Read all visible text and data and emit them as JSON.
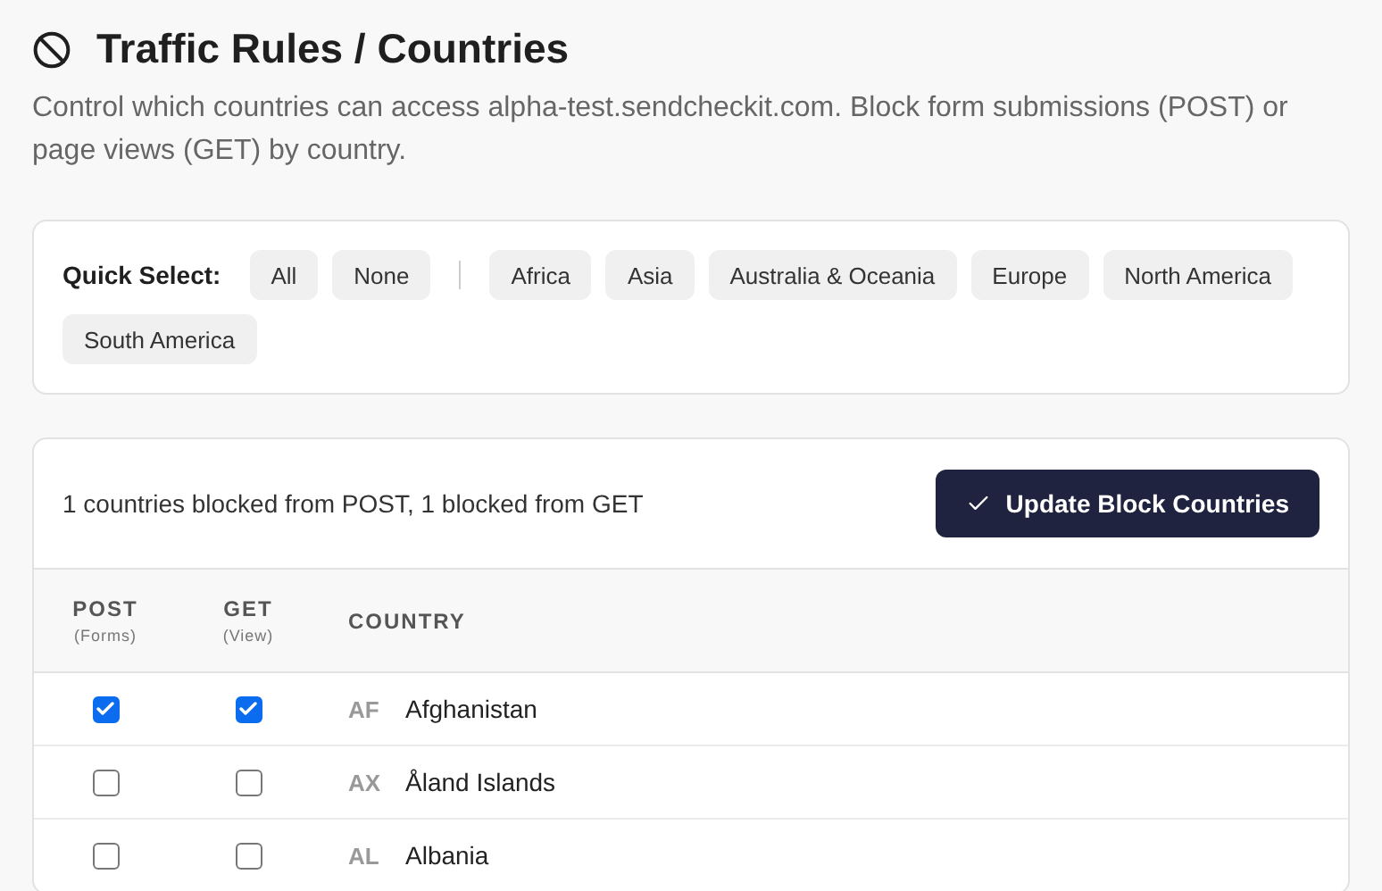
{
  "title": "Traffic Rules / Countries",
  "description": "Control which countries can access alpha-test.sendcheckit.com. Block form submissions (POST) or page views (GET) by country.",
  "quick_select": {
    "label": "Quick Select:",
    "primary": [
      "All",
      "None"
    ],
    "regions": [
      "Africa",
      "Asia",
      "Australia & Oceania",
      "Europe",
      "North America",
      "South America"
    ]
  },
  "summary": "1 countries blocked from POST, 1 blocked from GET",
  "update_button": "Update Block Countries",
  "columns": [
    {
      "label": "POST",
      "sub": "(Forms)"
    },
    {
      "label": "GET",
      "sub": "(View)"
    },
    {
      "label": "COUNTRY"
    }
  ],
  "rows": [
    {
      "code": "AF",
      "name": "Afghanistan",
      "post": true,
      "get": true
    },
    {
      "code": "AX",
      "name": "Åland Islands",
      "post": false,
      "get": false
    },
    {
      "code": "AL",
      "name": "Albania",
      "post": false,
      "get": false
    }
  ]
}
